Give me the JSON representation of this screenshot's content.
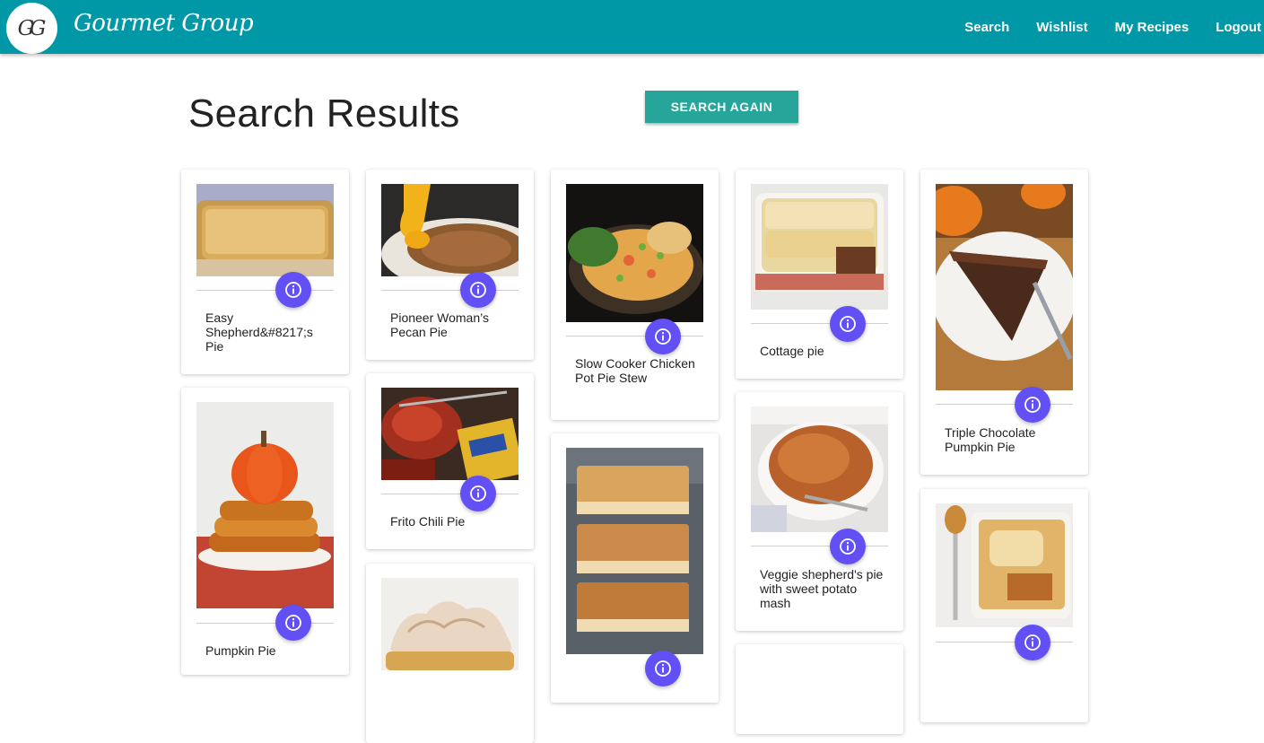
{
  "navbar": {
    "logo_text": "GG",
    "brand": "Gourmet Group",
    "links": [
      "Search",
      "Wishlist",
      "My Recipes",
      "Logout"
    ]
  },
  "page": {
    "title": "Search Results",
    "search_again_label": "SEARCH AGAIN"
  },
  "colors": {
    "navbar": "#0097a7",
    "button": "#26a69a",
    "info_button": "#6250f5"
  },
  "icons": {
    "info": "info-icon"
  },
  "recipes": [
    {
      "title": "Easy Shepherd&#8217;s Pie"
    },
    {
      "title": "Pioneer Woman’s Pecan Pie"
    },
    {
      "title": "Slow Cooker Chicken Pot Pie Stew"
    },
    {
      "title": "Cottage pie"
    },
    {
      "title": "Triple Chocolate Pumpkin Pie"
    },
    {
      "title": "Pumpkin Pie"
    },
    {
      "title": "Frito Chili Pie"
    },
    {
      "title": "Veggie shepherd's pie with sweet potato mash"
    },
    {
      "title": ""
    },
    {
      "title": ""
    },
    {
      "title": ""
    },
    {
      "title": ""
    }
  ]
}
